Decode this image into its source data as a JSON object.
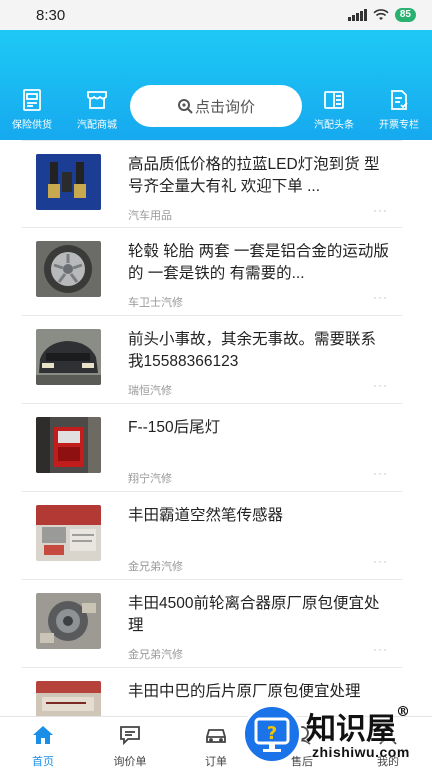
{
  "status_bar": {
    "time": "8:30",
    "battery": "85"
  },
  "header": {
    "nav_left": [
      {
        "label": "保险供货",
        "icon": "insurance-doc-icon"
      },
      {
        "label": "汽配商城",
        "icon": "store-icon"
      }
    ],
    "search": {
      "label": "点击询价",
      "icon": "search-icon"
    },
    "nav_right": [
      {
        "label": "汽配头条",
        "icon": "news-icon"
      },
      {
        "label": "开票专栏",
        "icon": "invoice-icon"
      }
    ]
  },
  "feed": [
    {
      "title": "高品质低价格的拉蓝LED灯泡到货 型号齐全量大有礼 欢迎下单 ...",
      "source": "汽车用品",
      "more": "···"
    },
    {
      "title": "轮毂 轮胎 两套 一套是铝合金的运动版的 一套是铁的 有需要的...",
      "source": "车卫士汽修",
      "more": "···"
    },
    {
      "title": "前头小事故，其余无事故。需要联系我15588366123",
      "source": "瑞恒汽修",
      "more": "···"
    },
    {
      "title": "F--150后尾灯",
      "source": "翔宁汽修",
      "more": "···"
    },
    {
      "title": "丰田霸道空然笔传感器",
      "source": "金兄弟汽修",
      "more": "···"
    },
    {
      "title": "丰田4500前轮离合器原厂原包便宜处理",
      "source": "金兄弟汽修",
      "more": "···"
    },
    {
      "title": "丰田中巴的后片原厂原包便宜处理",
      "source": "",
      "more": ""
    }
  ],
  "tabbar": [
    {
      "label": "首页",
      "icon": "home-icon",
      "active": true
    },
    {
      "label": "询价单",
      "icon": "inquiry-icon",
      "active": false
    },
    {
      "label": "订单",
      "icon": "order-car-icon",
      "active": false
    },
    {
      "label": "售后",
      "icon": "after-sales-icon",
      "active": false
    },
    {
      "label": "我的",
      "icon": "profile-icon",
      "active": false
    }
  ],
  "watermark": {
    "text": "知识屋",
    "sub": "zhishiwu.com",
    "mark": "®"
  },
  "colors": {
    "header_top": "#1ec9f5",
    "header_bottom": "#16a9ef",
    "accent": "#1b8ee8"
  }
}
